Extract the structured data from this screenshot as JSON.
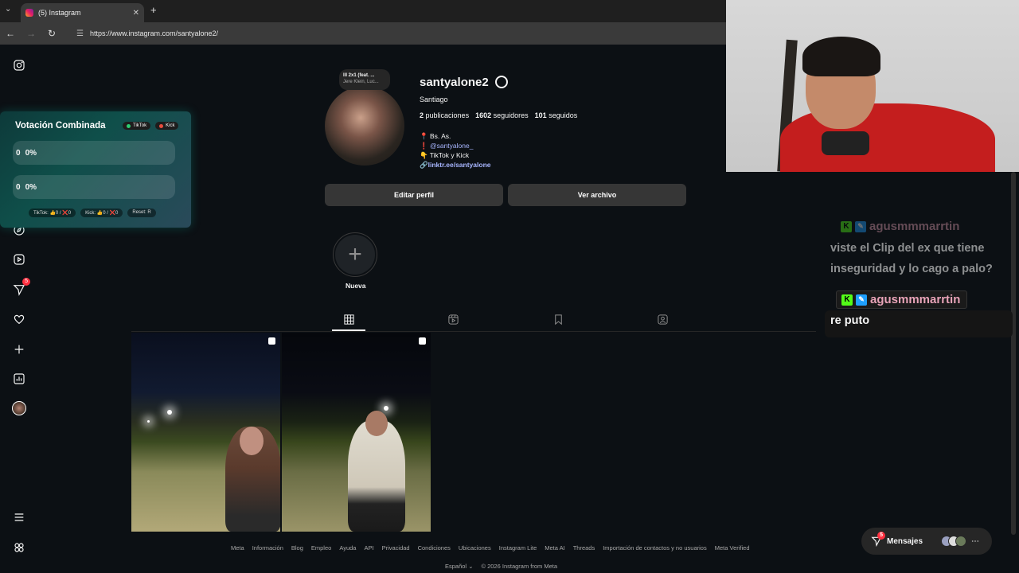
{
  "browser": {
    "tab_title": "(5) Instagram",
    "url": "https://www.instagram.com/santyalone2/"
  },
  "sidebar": {
    "icons": [
      "instagram-icon",
      "home-icon",
      "search-icon",
      "explore-icon",
      "reels-icon",
      "messages-icon",
      "notifications-icon",
      "create-icon",
      "dashboard-icon",
      "profile-icon",
      "menu-icon",
      "threads-icon"
    ],
    "messages_badge": "5"
  },
  "vote": {
    "title": "Votación Combinada",
    "tag_tiktok": "TikTok",
    "tag_kick": "Kick",
    "bar1_count": "0",
    "bar1_pct": "0%",
    "bar2_count": "0",
    "bar2_pct": "0%",
    "foot_tiktok": "TikTok: 👍0 / ❌0",
    "foot_kick": "Kick: 👍0 / ❌0",
    "foot_reset": "Reset: R"
  },
  "profile": {
    "note_line1": "lll 2x1 (feat. ...",
    "note_line2": "Jere Klein, Luc...",
    "username": "santyalone2",
    "full_name": "Santiago",
    "posts": "2",
    "posts_label": "publicaciones",
    "followers": "1602",
    "followers_label": "seguidores",
    "following": "101",
    "following_label": "seguidos",
    "bio_location": "📍 Bs. As.",
    "bio_mention": "@santyalone_",
    "bio_line3": "👇 TikTok y Kick",
    "bio_link": "linktr.ee/santyalone",
    "edit_button": "Editar perfil",
    "archive_button": "Ver archivo"
  },
  "highlights": {
    "new_label": "Nueva"
  },
  "footer": {
    "links": [
      "Meta",
      "Información",
      "Blog",
      "Empleo",
      "Ayuda",
      "API",
      "Privacidad",
      "Condiciones",
      "Ubicaciones",
      "Instagram Lite",
      "Meta AI",
      "Threads",
      "Importación de contactos y no usuarios",
      "Meta Verified"
    ],
    "language": "Español",
    "copyright": "© 2026 Instagram from Meta"
  },
  "messages": {
    "label": "Mensajes",
    "badge": "5"
  },
  "chat": {
    "msg1_user": "agusmmmarrtin",
    "msg1_text_line1": "viste el Clip del ex que tiene",
    "msg1_text_line2": "inseguridad y lo cago a palo?",
    "msg2_user": "agusmmmarrtin",
    "msg2_text": "re puto"
  },
  "colors": {
    "accent_link": "#a8b6ff",
    "badge_red": "#ff3040",
    "chat_username": "#e8a3b8",
    "kick_green": "#53fc18"
  }
}
